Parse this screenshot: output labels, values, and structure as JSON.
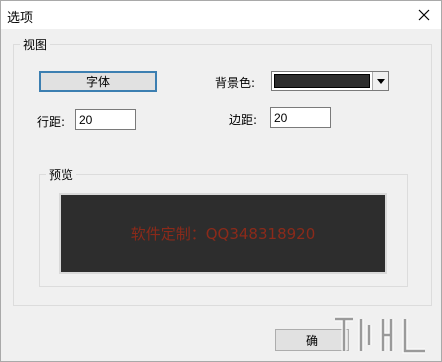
{
  "window": {
    "title": "选项"
  },
  "view_group": {
    "label": "视图"
  },
  "font_button": {
    "label": "字体"
  },
  "background": {
    "label": "背景色:",
    "color": "#2d2d2d"
  },
  "line_spacing": {
    "label": "行距:",
    "value": "20"
  },
  "margin": {
    "label": "边距:",
    "value": "20"
  },
  "preview_group": {
    "label": "预览",
    "text": "软件定制：QQ348318920",
    "text_color": "#8b2a1a",
    "bg_color": "#2d2d2d"
  },
  "ok_button": {
    "label": "确"
  },
  "colors": {
    "window_bg": "#f0f0f0",
    "focus_border": "#3c7fb1"
  }
}
